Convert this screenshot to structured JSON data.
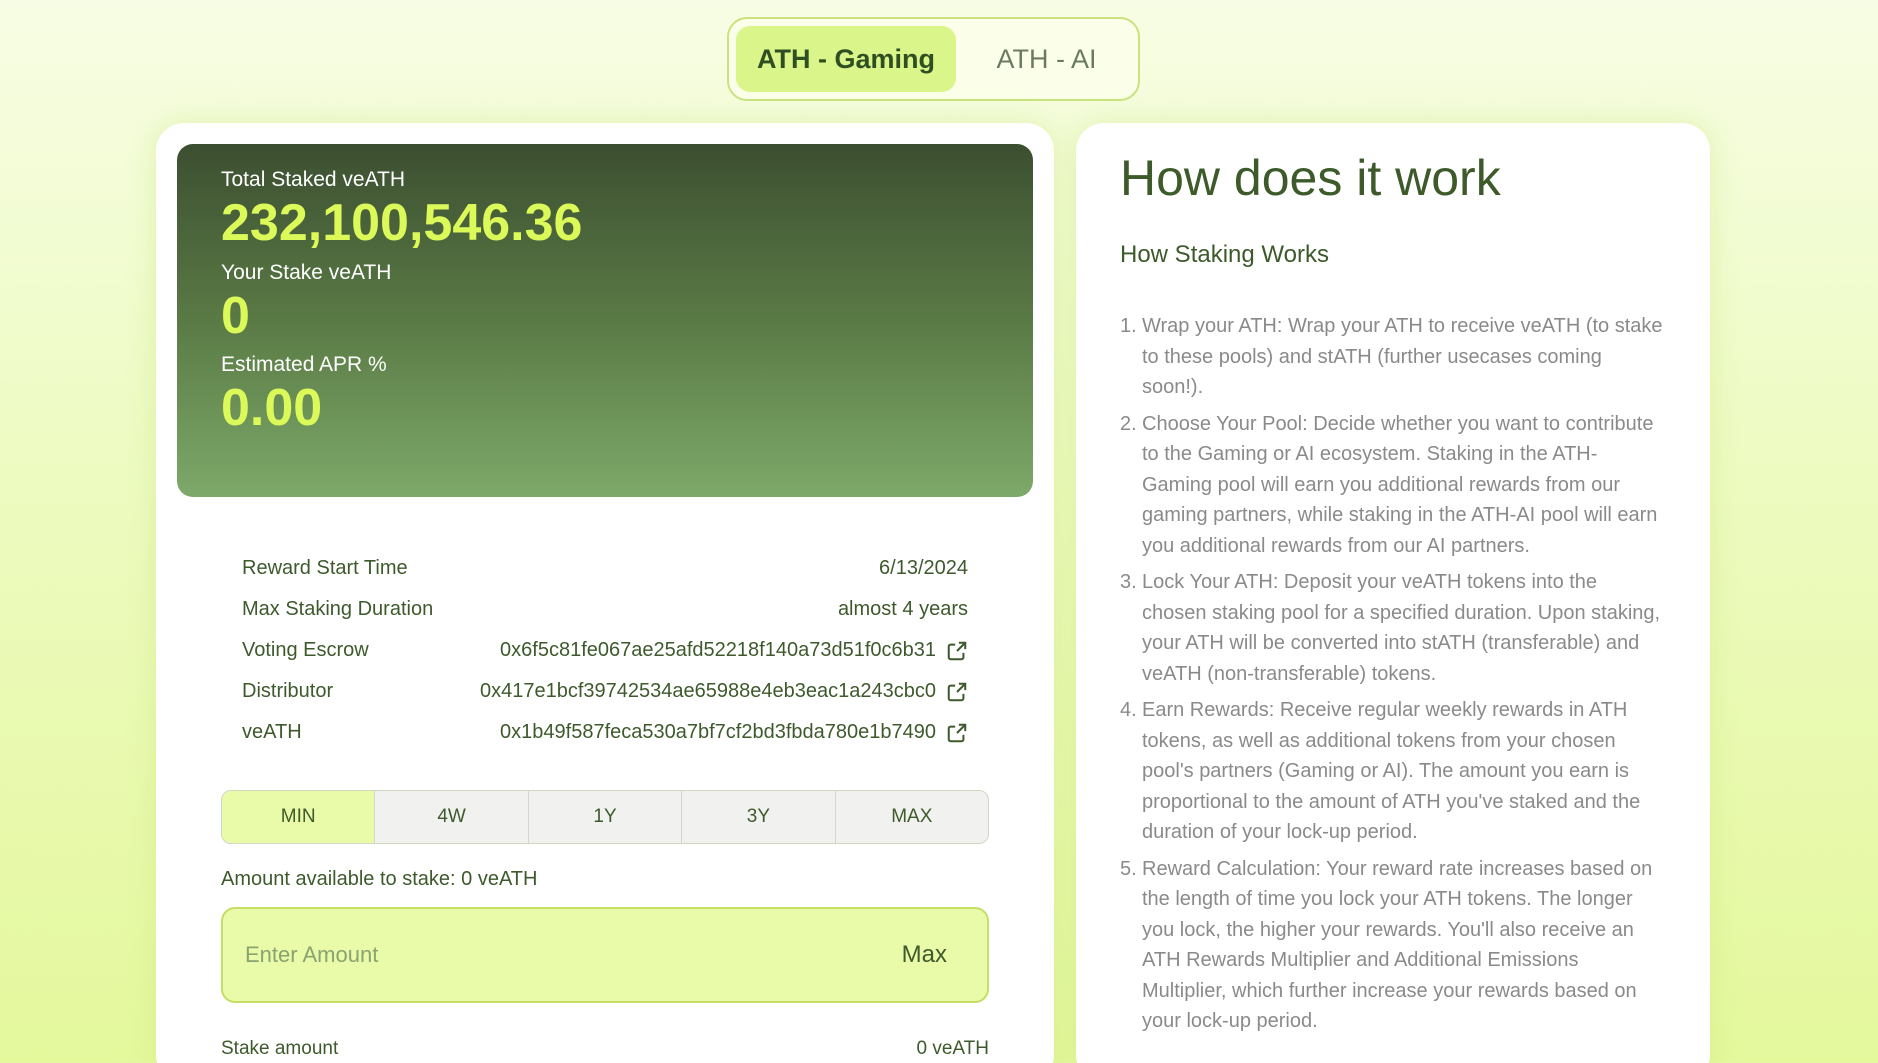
{
  "pool_toggle": {
    "tabs": [
      {
        "label": "ATH - Gaming",
        "active": true
      },
      {
        "label": "ATH - AI",
        "active": false
      }
    ]
  },
  "stats": {
    "total_staked_label": "Total Staked veATH",
    "total_staked_value": "232,100,546.36",
    "your_stake_label": "Your Stake veATH",
    "your_stake_value": "0",
    "apr_label": "Estimated APR %",
    "apr_value": "0.00"
  },
  "info": {
    "reward_start_label": "Reward Start Time",
    "reward_start_value": "6/13/2024",
    "max_duration_label": "Max Staking Duration",
    "max_duration_value": "almost 4 years",
    "voting_escrow_label": "Voting Escrow",
    "voting_escrow_value": "0x6f5c81fe067ae25afd52218f140a73d51f0c6b31",
    "distributor_label": "Distributor",
    "distributor_value": "0x417e1bcf39742534ae65988e4eb3eac1a243cbc0",
    "veath_label": "veATH",
    "veath_value": "0x1b49f587feca530a7bf7cf2bd3fbda780e1b7490"
  },
  "duration_options": [
    "MIN",
    "4W",
    "1Y",
    "3Y",
    "MAX"
  ],
  "stake_form": {
    "available_text": "Amount available to stake: 0 veATH",
    "amount_placeholder": "Enter Amount",
    "amount_value": "",
    "max_label": "Max",
    "stake_amount_label": "Stake amount",
    "stake_amount_value": "0 veATH"
  },
  "how_it_works": {
    "title": "How does it work",
    "subtitle": "How Staking Works",
    "steps": [
      "Wrap your ATH: Wrap your ATH to receive veATH (to stake to these pools) and stATH (further usecases coming soon!).",
      "Choose Your Pool: Decide whether you want to contribute to the Gaming or AI ecosystem. Staking in the ATH-Gaming pool will earn you additional rewards from our gaming partners, while staking in the ATH-AI pool will earn you additional rewards from our AI partners.",
      "Lock Your ATH: Deposit your veATH tokens into the chosen staking pool for a specified duration. Upon staking, your ATH will be converted into stATH (transferable) and veATH (non-transferable) tokens.",
      "Earn Rewards: Receive regular weekly rewards in ATH tokens, as well as additional tokens from your chosen pool's partners (Gaming or AI). The amount you earn is proportional to the amount of ATH you've staked and the duration of your lock-up period.",
      "Reward Calculation: Your reward rate increases based on the length of time you lock your ATH tokens. The longer you lock, the higher your rewards. You'll also receive an ATH Rewards Multiplier and Additional Emissions Multiplier, which further increase your rewards based on your lock-up period."
    ]
  },
  "colors": {
    "accent": "#daf58a",
    "stat_value": "#dcf95a",
    "text_dark": "#3e5a2c"
  }
}
